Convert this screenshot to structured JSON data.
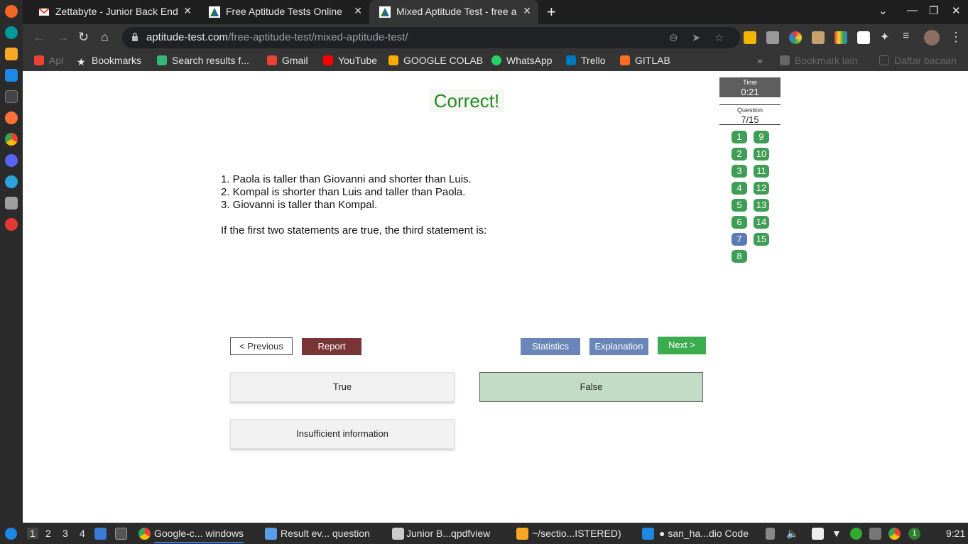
{
  "browser": {
    "tabs": [
      {
        "title": "Zettabyte - Junior Back End",
        "icon": "gmail-icon",
        "active": false
      },
      {
        "title": "Free Aptitude Tests Online",
        "icon": "aptitude-icon",
        "active": false
      },
      {
        "title": "Mixed Aptitude Test - free a",
        "icon": "aptitude-icon",
        "active": true
      }
    ],
    "url_domain": "aptitude-test.com",
    "url_path": "/free-aptitude-test/mixed-aptitude-test/",
    "bookmarks": [
      {
        "label": "Apl",
        "color": "#ea4335"
      },
      {
        "label": "Bookmarks",
        "color": "#e8e8e8"
      },
      {
        "label": "Search results f...",
        "color": "#35b779"
      },
      {
        "label": "Gmail",
        "color": "#ea4335"
      },
      {
        "label": "YouTube",
        "color": "#ff0000"
      },
      {
        "label": "GOOGLE COLAB",
        "color": "#f9ab00"
      },
      {
        "label": "WhatsApp",
        "color": "#25d366"
      },
      {
        "label": "Trello",
        "color": "#0079bf"
      },
      {
        "label": "GITLAB",
        "color": "#fc6d26"
      }
    ],
    "bookmarks_other": "Bookmark lain",
    "reading_list": "Daftar bacaan"
  },
  "quiz": {
    "feedback": "Correct!",
    "statements": [
      "1. Paola is taller than Giovanni and shorter than Luis.",
      "2. Kompal is shorter than Luis and taller than Paola.",
      "3. Giovanni is taller than Kompal."
    ],
    "prompt": "If the first two statements are true, the third statement is:",
    "time_label": "Time",
    "time_value": "0:21",
    "question_label": "Question",
    "question_value": "7/15",
    "question_numbers": [
      "1",
      "2",
      "3",
      "4",
      "5",
      "6",
      "7",
      "8",
      "9",
      "10",
      "11",
      "12",
      "13",
      "14",
      "15"
    ],
    "current_question": "7",
    "buttons": {
      "previous": "<  Previous",
      "report": "Report",
      "statistics": "Statistics",
      "explanation": "Explanation",
      "next": "Next  >"
    },
    "answers": [
      "True",
      "False",
      "Insufficient information"
    ],
    "selected_answer": "False"
  },
  "taskbar": {
    "workspaces": [
      "1",
      "2",
      "3",
      "4"
    ],
    "windows": [
      "Google-c... windows",
      "Result ev... question",
      "Junior B...qpdfview",
      "~/sectio...ISTERED)",
      "san_ha...dio Code"
    ],
    "notification_count": "1",
    "clock": "9:21"
  }
}
